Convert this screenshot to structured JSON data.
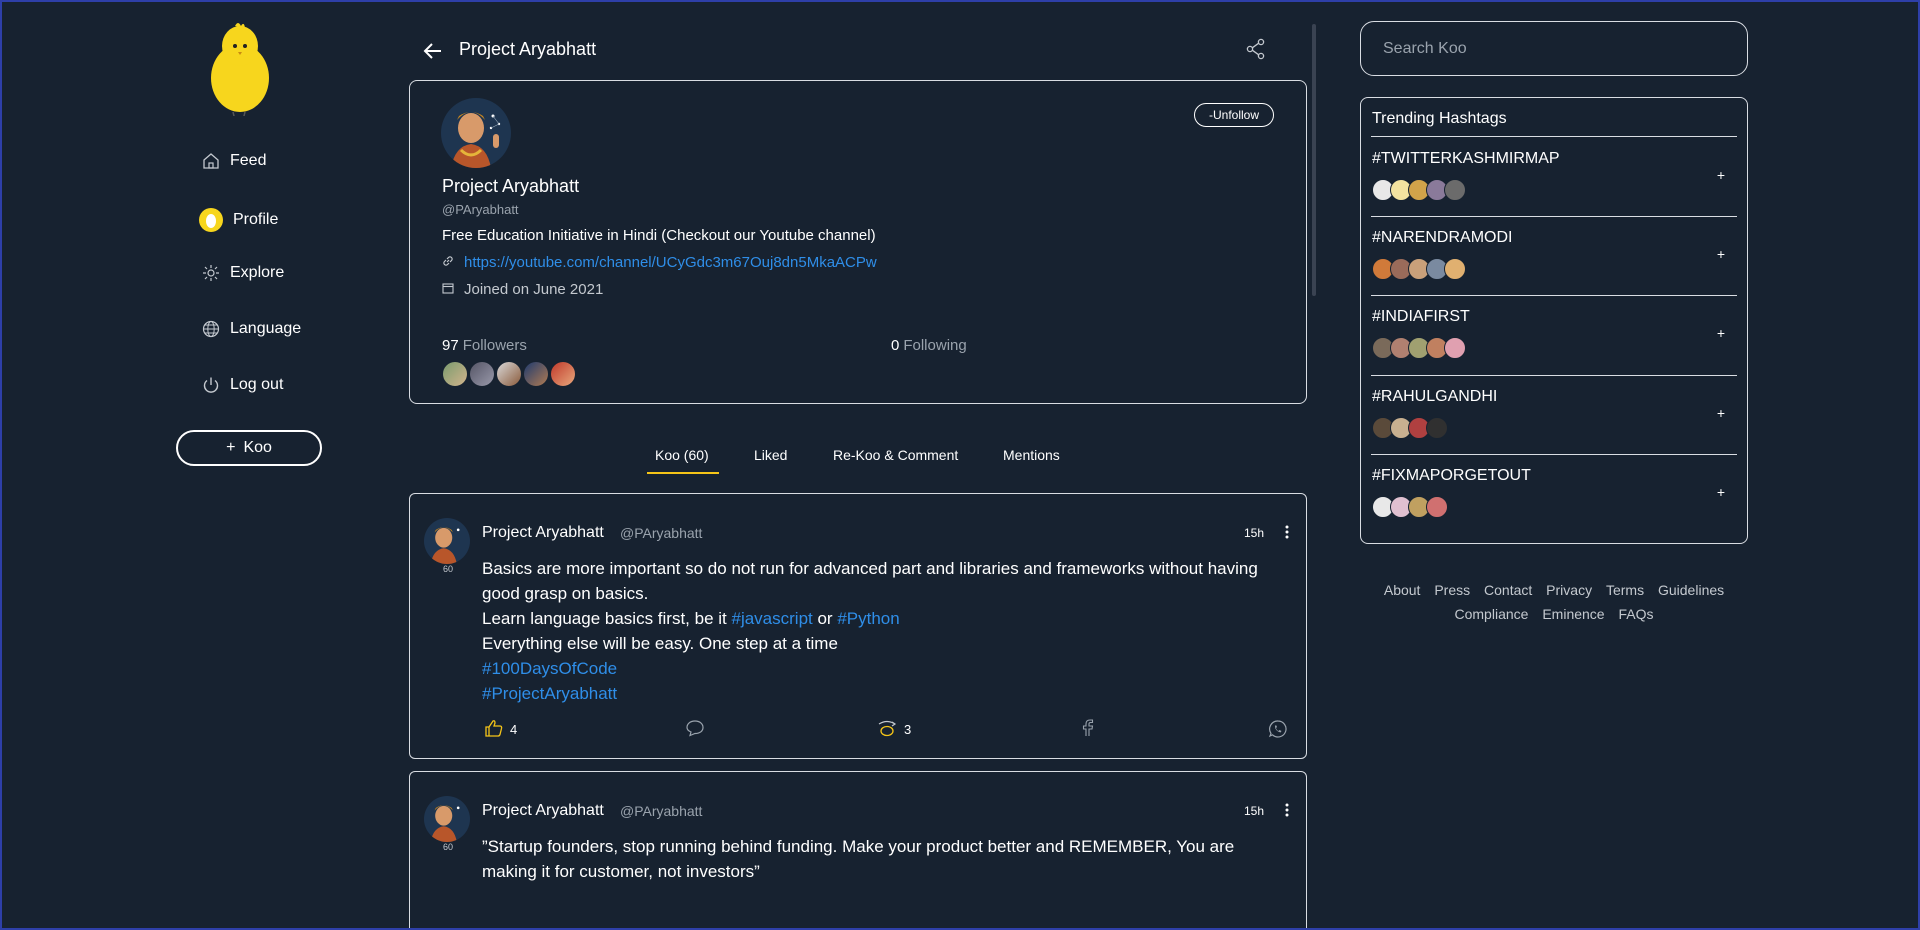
{
  "nav": {
    "items": [
      {
        "label": "Feed",
        "icon": "home-icon"
      },
      {
        "label": "Profile",
        "icon": "profile-avatar-icon"
      },
      {
        "label": "Explore",
        "icon": "explore-icon"
      },
      {
        "label": "Language",
        "icon": "globe-icon"
      },
      {
        "label": "Log out",
        "icon": "power-icon"
      }
    ],
    "koo_button": "Koo",
    "koo_button_icon": "+"
  },
  "header": {
    "title": "Project Aryabhatt"
  },
  "profile": {
    "name": "Project Aryabhatt",
    "handle": "@PAryabhatt",
    "unfollow_label": "-Unfollow",
    "bio": "Free Education Initiative in Hindi (Checkout our Youtube channel)",
    "link": "https://youtube.com/channel/UCyGdc3m67Ouj8dn5MkaACPw",
    "joined": "Joined on June 2021",
    "followers_count": "97",
    "followers_label": "Followers",
    "following_count": "0",
    "following_label": "Following"
  },
  "tabs": [
    "Koo (60)",
    "Liked",
    "Re-Koo & Comment",
    "Mentions"
  ],
  "posts": [
    {
      "author": "Project Aryabhatt",
      "handle": "@PAryabhatt",
      "time": "15h",
      "avatar_badge": "60",
      "lines": [
        "Basics are more important so do not run for advanced part and libraries and frameworks without having good grasp on basics."
      ],
      "line2_pre": "Learn language basics first, be it ",
      "tag_js": "#javascript",
      "line2_mid": " or ",
      "tag_py": "#Python",
      "line3": "Everything else will be easy. One step at a time",
      "tag_100": "#100DaysOfCode",
      "tag_pa": "#ProjectAryabhatt",
      "likes": "4",
      "rekoos": "3"
    },
    {
      "author": "Project Aryabhatt",
      "handle": "@PAryabhatt",
      "time": "15h",
      "avatar_badge": "60",
      "text": "”Startup founders, stop running behind funding. Make your product better and REMEMBER, You are making it for customer, not investors”"
    }
  ],
  "search": {
    "placeholder": "Search Koo"
  },
  "trending": {
    "title": "Trending Hashtags",
    "items": [
      {
        "tag": "#TWITTERKASHMIRMAP",
        "plus": "+"
      },
      {
        "tag": "#NARENDRAMODI",
        "plus": "+"
      },
      {
        "tag": "#INDIAFIRST",
        "plus": "+"
      },
      {
        "tag": "#RAHULGANDHI",
        "plus": "+"
      },
      {
        "tag": "#FIXMAPORGETOUT",
        "plus": "+"
      }
    ]
  },
  "footer": {
    "row1": [
      "About",
      "Press",
      "Contact",
      "Privacy",
      "Terms",
      "Guidelines"
    ],
    "row2": [
      "Compliance",
      "Eminence",
      "FAQs"
    ]
  },
  "colors": {
    "background": "#172230",
    "link": "#2f8ee8",
    "accent": "#f5c518"
  }
}
